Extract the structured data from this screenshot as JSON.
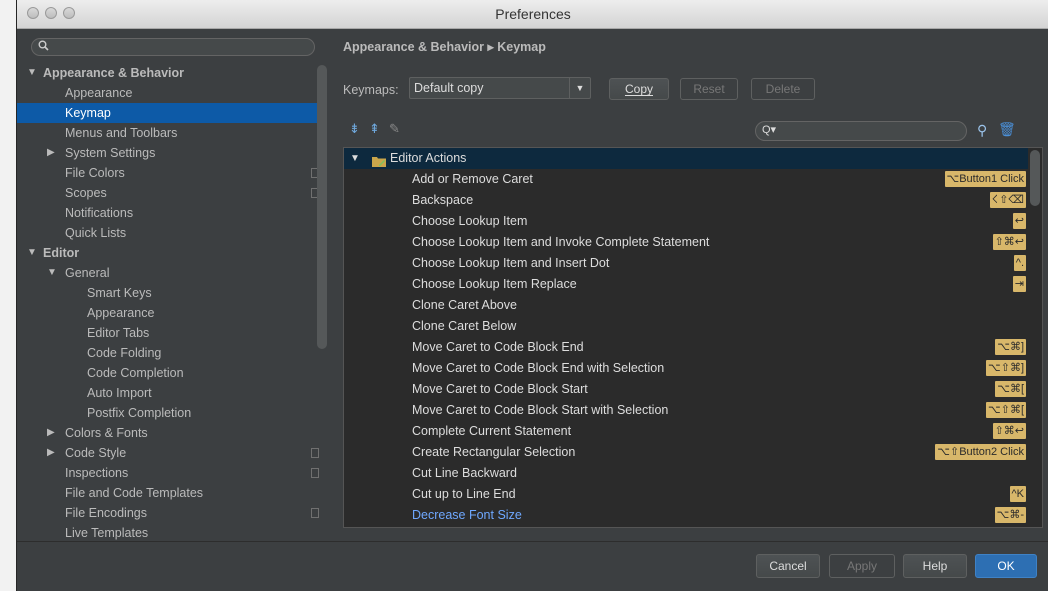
{
  "window": {
    "title": "Preferences"
  },
  "sidebar": {
    "search_icon": "search-icon",
    "items": [
      {
        "label": "Appearance & Behavior",
        "level": 0,
        "expander": "▼",
        "head": true
      },
      {
        "label": "Appearance",
        "level": 1
      },
      {
        "label": "Keymap",
        "level": 1,
        "selected": true
      },
      {
        "label": "Menus and Toolbars",
        "level": 1
      },
      {
        "label": "System Settings",
        "level": 1,
        "expander": "▶"
      },
      {
        "label": "File Colors",
        "level": 1,
        "project": true
      },
      {
        "label": "Scopes",
        "level": 1,
        "project": true
      },
      {
        "label": "Notifications",
        "level": 1
      },
      {
        "label": "Quick Lists",
        "level": 1
      },
      {
        "label": "Editor",
        "level": 0,
        "expander": "▼",
        "head": true
      },
      {
        "label": "General",
        "level": 1,
        "expander": "▼"
      },
      {
        "label": "Smart Keys",
        "level": 2
      },
      {
        "label": "Appearance",
        "level": 2
      },
      {
        "label": "Editor Tabs",
        "level": 2
      },
      {
        "label": "Code Folding",
        "level": 2
      },
      {
        "label": "Code Completion",
        "level": 2
      },
      {
        "label": "Auto Import",
        "level": 2
      },
      {
        "label": "Postfix Completion",
        "level": 2
      },
      {
        "label": "Colors & Fonts",
        "level": 1,
        "expander": "▶"
      },
      {
        "label": "Code Style",
        "level": 1,
        "expander": "▶",
        "project": true
      },
      {
        "label": "Inspections",
        "level": 1,
        "project": true
      },
      {
        "label": "File and Code Templates",
        "level": 1
      },
      {
        "label": "File Encodings",
        "level": 1,
        "project": true
      },
      {
        "label": "Live Templates",
        "level": 1
      }
    ]
  },
  "main": {
    "breadcrumb": "Appearance & Behavior ▸ Keymap",
    "keymaps_label": "Keymaps:",
    "keymap_value": "Default copy",
    "buttons": {
      "copy": "Copy",
      "reset": "Reset",
      "delete": "Delete"
    },
    "toolbar": {
      "expand_all": "⇟",
      "collapse_all": "⇞",
      "edit": "✎",
      "find": "⚲",
      "trash": "🗑"
    },
    "search": {
      "icon": "Q▾"
    },
    "group": {
      "label": "Editor Actions",
      "expander": "▼"
    },
    "actions": [
      {
        "label": "Add or Remove Caret",
        "shortcuts": [
          "⌥Button1 Click"
        ]
      },
      {
        "label": "Backspace",
        "shortcuts": [
          "⌫",
          "⇧⌫"
        ]
      },
      {
        "label": "Choose Lookup Item",
        "shortcuts": [
          "↩"
        ]
      },
      {
        "label": "Choose Lookup Item and Invoke Complete Statement",
        "shortcuts": [
          "⇧⌘↩"
        ]
      },
      {
        "label": "Choose Lookup Item and Insert Dot",
        "shortcuts": [
          "^."
        ]
      },
      {
        "label": "Choose Lookup Item Replace",
        "shortcuts": [
          "⇥"
        ]
      },
      {
        "label": "Clone Caret Above",
        "shortcuts": []
      },
      {
        "label": "Clone Caret Below",
        "shortcuts": []
      },
      {
        "label": "Move Caret to Code Block End",
        "shortcuts": [
          "⌥⌘]"
        ]
      },
      {
        "label": "Move Caret to Code Block End with Selection",
        "shortcuts": [
          "⌥⇧⌘]"
        ]
      },
      {
        "label": "Move Caret to Code Block Start",
        "shortcuts": [
          "⌥⌘["
        ]
      },
      {
        "label": "Move Caret to Code Block Start with Selection",
        "shortcuts": [
          "⌥⇧⌘["
        ]
      },
      {
        "label": "Complete Current Statement",
        "shortcuts": [
          "⇧⌘↩"
        ]
      },
      {
        "label": "Create Rectangular Selection",
        "shortcuts": [
          "⌥⇧Button2 Click"
        ]
      },
      {
        "label": "Cut Line Backward",
        "shortcuts": []
      },
      {
        "label": "Cut up to Line End",
        "shortcuts": [
          "^K"
        ]
      },
      {
        "label": "Decrease Font Size",
        "shortcuts": [
          "⌥⌘-"
        ],
        "link": true
      }
    ]
  },
  "footer": {
    "cancel": "Cancel",
    "apply": "Apply",
    "help": "Help",
    "ok": "OK"
  },
  "colors": {
    "accent": "#0d5aa7",
    "shortcut_bg": "#d8b76a",
    "list_bg": "#2b2b2b",
    "ok_bg": "#2d6fb3"
  }
}
